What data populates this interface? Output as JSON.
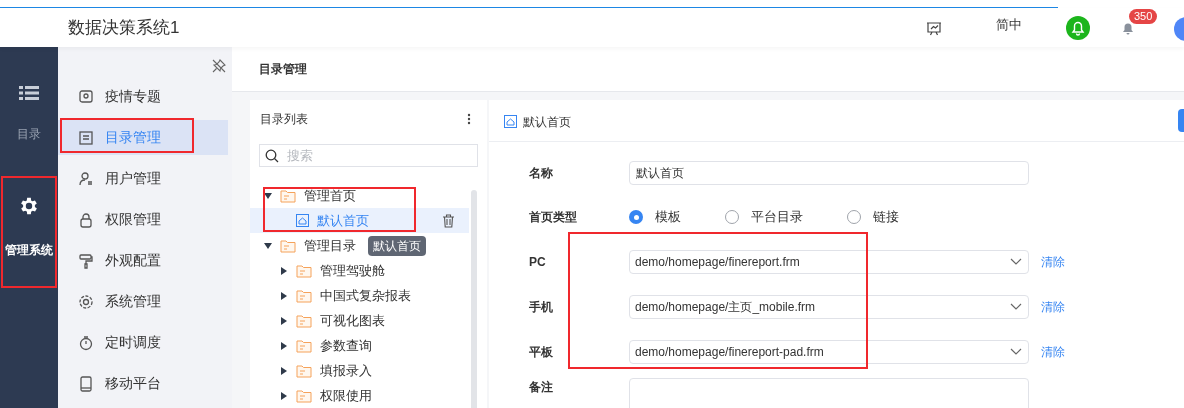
{
  "header": {
    "title": "数据决策系统1",
    "language": "简中",
    "badge": "350"
  },
  "rail": {
    "items": [
      {
        "label": "目录",
        "kind": "list",
        "selected": false
      },
      {
        "label": "管理系统",
        "kind": "gear",
        "selected": true
      }
    ]
  },
  "menu": {
    "items": [
      {
        "label": "疫情专题",
        "selected": false
      },
      {
        "label": "目录管理",
        "selected": true
      },
      {
        "label": "用户管理",
        "selected": false
      },
      {
        "label": "权限管理",
        "selected": false
      },
      {
        "label": "外观配置",
        "selected": false
      },
      {
        "label": "系统管理",
        "selected": false
      },
      {
        "label": "定时调度",
        "selected": false
      },
      {
        "label": "移动平台",
        "selected": false
      }
    ]
  },
  "page_title": "目录管理",
  "tree": {
    "title": "目录列表",
    "search_placeholder": "搜索",
    "tooltip": "默认首页",
    "items": [
      {
        "label": "管理首页",
        "kind": "folder",
        "expanded": true,
        "children": [
          {
            "label": "默认首页",
            "kind": "page",
            "selected": true
          }
        ]
      },
      {
        "label": "管理目录",
        "kind": "folder",
        "expanded": true,
        "children": [
          {
            "label": "管理驾驶舱",
            "kind": "folder",
            "expanded": false
          },
          {
            "label": "中国式复杂报表",
            "kind": "folder",
            "expanded": false
          },
          {
            "label": "可视化图表",
            "kind": "folder",
            "expanded": false
          },
          {
            "label": "参数查询",
            "kind": "folder",
            "expanded": false
          },
          {
            "label": "填报录入",
            "kind": "folder",
            "expanded": false
          },
          {
            "label": "权限使用",
            "kind": "folder",
            "expanded": false
          }
        ]
      }
    ]
  },
  "detail": {
    "title": "默认首页",
    "fields": [
      {
        "label": "名称",
        "kind": "text",
        "value": "默认首页"
      },
      {
        "label": "首页类型",
        "kind": "radio",
        "options": [
          {
            "label": "模板",
            "selected": true
          },
          {
            "label": "平台目录",
            "selected": false
          },
          {
            "label": "链接",
            "selected": false
          }
        ]
      },
      {
        "label": "PC",
        "kind": "select",
        "value": "demo/homepage/finereport.frm",
        "action": "清除"
      },
      {
        "label": "手机",
        "kind": "select",
        "value": "demo/homepage/主页_mobile.frm",
        "action": "清除"
      },
      {
        "label": "平板",
        "kind": "select",
        "value": "demo/homepage/finereport-pad.frm",
        "action": "清除"
      },
      {
        "label": "备注",
        "kind": "textarea"
      }
    ]
  }
}
